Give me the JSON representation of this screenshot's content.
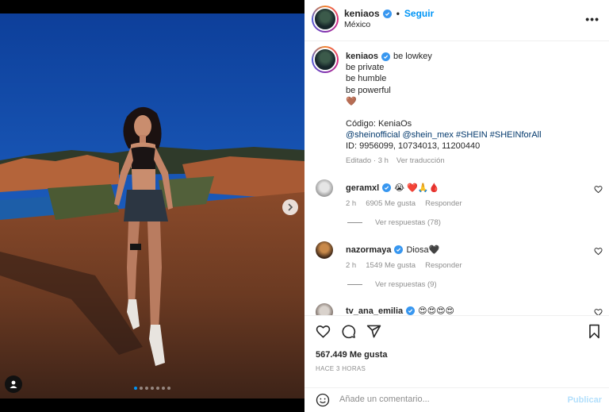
{
  "header": {
    "username": "keniaos",
    "follow_label": "Seguir",
    "location": "México",
    "more_icon": "more-horizontal-icon"
  },
  "caption": {
    "username": "keniaos",
    "lines": [
      "be lowkey",
      "be private",
      "be humble",
      "be powerful"
    ],
    "emoji": "🤎",
    "code_line": "Código: KeniaOs",
    "mention_1": "@sheinofficial",
    "mention_2": "@shein_mex",
    "hashtag_1": "#SHEIN",
    "hashtag_2": "#SHEINforAll",
    "id_line": "ID: 9956099, 10734013, 11200440",
    "edited": "Editado",
    "time": "3 h",
    "translate": "Ver traducción"
  },
  "comments": [
    {
      "username": "geramxl",
      "text": "😭 ❤️🙏🩸",
      "time": "2 h",
      "likes": "6905 Me gusta",
      "reply_label": "Responder",
      "replies_label": "Ver respuestas (78)"
    },
    {
      "username": "nazormaya",
      "text": "Diosa🖤",
      "time": "2 h",
      "likes": "1549 Me gusta",
      "reply_label": "Responder",
      "replies_label": "Ver respuestas (9)"
    },
    {
      "username": "tv_ana_emilia",
      "text": "😍😍😍😍"
    }
  ],
  "actions": {
    "likes": "567.449 Me gusta",
    "posted": "HACE 3 HORAS"
  },
  "add_comment": {
    "placeholder": "Añade un comentario...",
    "publish_label": "Publicar"
  },
  "carousel": {
    "total": 7,
    "active_index": 0
  },
  "colors": {
    "accent": "#0095f6",
    "mention": "#00376b",
    "muted": "#8e8e8e",
    "verified": "#3897f0"
  }
}
